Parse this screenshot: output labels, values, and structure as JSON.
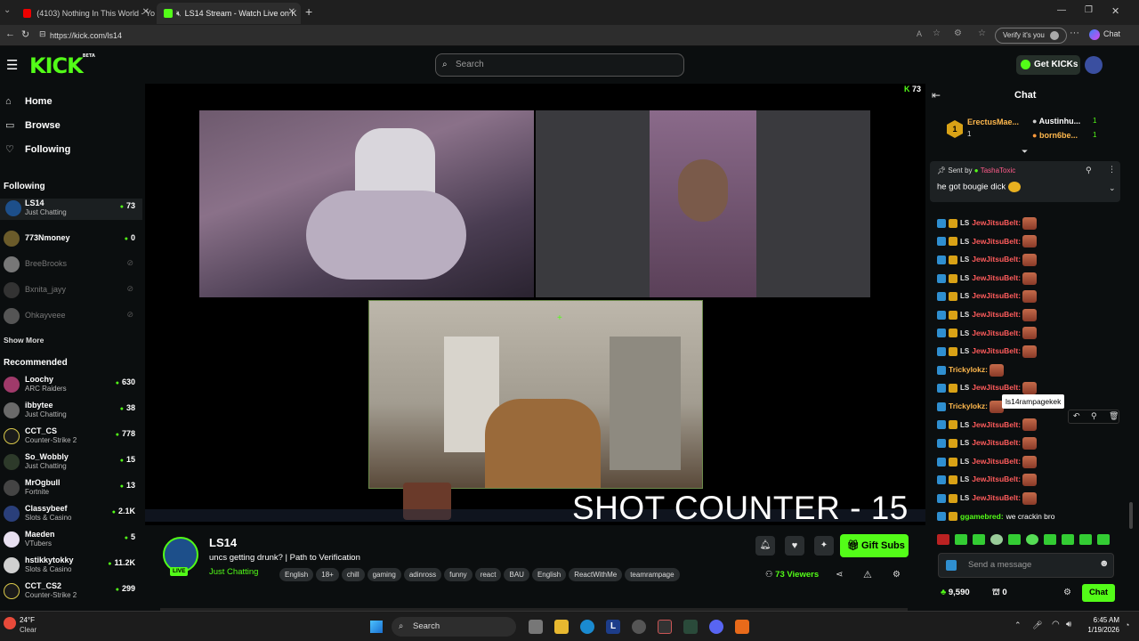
{
  "browser": {
    "tabs": [
      {
        "title": "(4103) Nothing In This World - Yo"
      },
      {
        "title": "LS14 Stream - Watch Live on K"
      }
    ],
    "url": "https://kick.com/ls14",
    "verify_label": "Verify it's you",
    "chat_label": "Chat"
  },
  "header": {
    "logo": "KICK",
    "logo_badge": "BETA",
    "search_placeholder": "Search",
    "get_kicks": "Get KICKs"
  },
  "sidebar": {
    "nav": [
      {
        "label": "Home",
        "icon": "home-icon"
      },
      {
        "label": "Browse",
        "icon": "browse-icon"
      },
      {
        "label": "Following",
        "icon": "heart-icon"
      }
    ],
    "following_label": "Following",
    "following": [
      {
        "name": "LS14",
        "category": "Just Chatting",
        "viewers": "73"
      },
      {
        "name": "773Nmoney",
        "category": "",
        "viewers": "0"
      },
      {
        "name": "BreeBrooks",
        "category": "",
        "viewers": ""
      },
      {
        "name": "Bxnita_jayy",
        "category": "",
        "viewers": ""
      },
      {
        "name": "Ohkayveee",
        "category": "",
        "viewers": ""
      }
    ],
    "show_more": "Show More",
    "recommended_label": "Recommended",
    "recommended": [
      {
        "name": "Loochy",
        "category": "ARC Raiders",
        "viewers": "630"
      },
      {
        "name": "ibbytee",
        "category": "Just Chatting",
        "viewers": "38"
      },
      {
        "name": "CCT_CS",
        "category": "Counter-Strike 2",
        "viewers": "778"
      },
      {
        "name": "So_Wobbly",
        "category": "Just Chatting",
        "viewers": "15"
      },
      {
        "name": "MrOgbull",
        "category": "Fortnite",
        "viewers": "13"
      },
      {
        "name": "Classybeef",
        "category": "Slots & Casino",
        "viewers": "2.1K"
      },
      {
        "name": "Maeden",
        "category": "VTubers",
        "viewers": "5"
      },
      {
        "name": "hstikkytokky",
        "category": "Slots & Casino",
        "viewers": "11.2K"
      },
      {
        "name": "CCT_CS2",
        "category": "Counter-Strike 2",
        "viewers": "299"
      }
    ]
  },
  "player": {
    "viewer_badge": "73",
    "overlay_text": "SHOT COUNTER - 15"
  },
  "stream": {
    "channel": "LS14",
    "live_badge": "LIVE",
    "title": "uncs getting drunk? | Path to Verification",
    "category": "Just Chatting",
    "tags": [
      "English",
      "18+",
      "chill",
      "gaming",
      "adinross",
      "funny",
      "react",
      "BAU",
      "English",
      "ReactWithMe",
      "teamrampage"
    ],
    "gift_subs": "Gift Subs",
    "viewers": "73 Viewers"
  },
  "chat": {
    "title": "Chat",
    "leaderboard": [
      {
        "rank": "1",
        "name": "ErectusMae...",
        "count": "1"
      },
      {
        "name": "Austinhu...",
        "count": "1"
      },
      {
        "name": "born6be...",
        "count": "1"
      }
    ],
    "pinned": {
      "sent_by_label": "Sent by",
      "sender": "TashaToxic",
      "text": "he got bougie dick"
    },
    "messages": [
      {
        "user": "JewJitsuBelt:",
        "color": "#ff5c5c",
        "text": ""
      },
      {
        "user": "JewJitsuBelt:",
        "color": "#ff5c5c",
        "text": ""
      },
      {
        "user": "JewJitsuBelt:",
        "color": "#ff5c5c",
        "text": ""
      },
      {
        "user": "JewJitsuBelt:",
        "color": "#ff5c5c",
        "text": ""
      },
      {
        "user": "JewJitsuBelt:",
        "color": "#ff5c5c",
        "text": ""
      },
      {
        "user": "JewJitsuBelt:",
        "color": "#ff5c5c",
        "text": ""
      },
      {
        "user": "JewJitsuBelt:",
        "color": "#ff5c5c",
        "text": ""
      },
      {
        "user": "JewJitsuBelt:",
        "color": "#ff5c5c",
        "text": ""
      },
      {
        "user": "Trickylokz:",
        "color": "#ffb84d",
        "text": ""
      },
      {
        "user": "JewJitsuBelt:",
        "color": "#ff5c5c",
        "text": ""
      },
      {
        "user": "Trickylokz:",
        "color": "#ffb84d",
        "text": ""
      },
      {
        "user": "JewJitsuBelt:",
        "color": "#ff5c5c",
        "text": ""
      },
      {
        "user": "JewJitsuBelt:",
        "color": "#ff5c5c",
        "text": ""
      },
      {
        "user": "JewJitsuBelt:",
        "color": "#ff5c5c",
        "text": ""
      },
      {
        "user": "JewJitsuBelt:",
        "color": "#ff5c5c",
        "text": ""
      },
      {
        "user": "JewJitsuBelt:",
        "color": "#ff5c5c",
        "text": ""
      },
      {
        "user": "ggamebred:",
        "color": "#53fc18",
        "text": "we crackin bro"
      }
    ],
    "tooltip": "ls14rampagekek",
    "input_placeholder": "Send a message",
    "points": "9,590",
    "gifts": "0",
    "send_label": "Chat"
  },
  "taskbar": {
    "weather_temp": "24°F",
    "weather_desc": "Clear",
    "search_label": "Search",
    "time": "6:45 AM",
    "date": "1/19/2026"
  },
  "colors": {
    "accent": "#53fc18",
    "background": "#0b0e0f"
  }
}
